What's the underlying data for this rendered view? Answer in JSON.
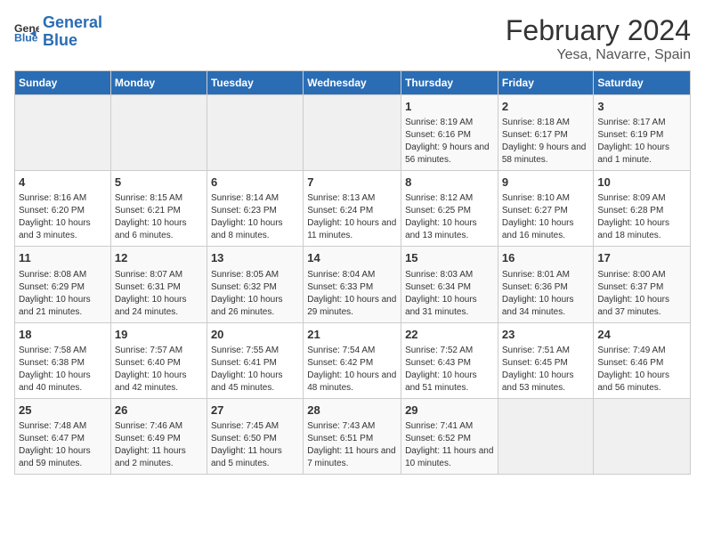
{
  "logo": {
    "line1": "General",
    "line2": "Blue"
  },
  "title": "February 2024",
  "subtitle": "Yesa, Navarre, Spain",
  "headers": [
    "Sunday",
    "Monday",
    "Tuesday",
    "Wednesday",
    "Thursday",
    "Friday",
    "Saturday"
  ],
  "weeks": [
    [
      {
        "day": "",
        "info": ""
      },
      {
        "day": "",
        "info": ""
      },
      {
        "day": "",
        "info": ""
      },
      {
        "day": "",
        "info": ""
      },
      {
        "day": "1",
        "info": "Sunrise: 8:19 AM\nSunset: 6:16 PM\nDaylight: 9 hours and 56 minutes."
      },
      {
        "day": "2",
        "info": "Sunrise: 8:18 AM\nSunset: 6:17 PM\nDaylight: 9 hours and 58 minutes."
      },
      {
        "day": "3",
        "info": "Sunrise: 8:17 AM\nSunset: 6:19 PM\nDaylight: 10 hours and 1 minute."
      }
    ],
    [
      {
        "day": "4",
        "info": "Sunrise: 8:16 AM\nSunset: 6:20 PM\nDaylight: 10 hours and 3 minutes."
      },
      {
        "day": "5",
        "info": "Sunrise: 8:15 AM\nSunset: 6:21 PM\nDaylight: 10 hours and 6 minutes."
      },
      {
        "day": "6",
        "info": "Sunrise: 8:14 AM\nSunset: 6:23 PM\nDaylight: 10 hours and 8 minutes."
      },
      {
        "day": "7",
        "info": "Sunrise: 8:13 AM\nSunset: 6:24 PM\nDaylight: 10 hours and 11 minutes."
      },
      {
        "day": "8",
        "info": "Sunrise: 8:12 AM\nSunset: 6:25 PM\nDaylight: 10 hours and 13 minutes."
      },
      {
        "day": "9",
        "info": "Sunrise: 8:10 AM\nSunset: 6:27 PM\nDaylight: 10 hours and 16 minutes."
      },
      {
        "day": "10",
        "info": "Sunrise: 8:09 AM\nSunset: 6:28 PM\nDaylight: 10 hours and 18 minutes."
      }
    ],
    [
      {
        "day": "11",
        "info": "Sunrise: 8:08 AM\nSunset: 6:29 PM\nDaylight: 10 hours and 21 minutes."
      },
      {
        "day": "12",
        "info": "Sunrise: 8:07 AM\nSunset: 6:31 PM\nDaylight: 10 hours and 24 minutes."
      },
      {
        "day": "13",
        "info": "Sunrise: 8:05 AM\nSunset: 6:32 PM\nDaylight: 10 hours and 26 minutes."
      },
      {
        "day": "14",
        "info": "Sunrise: 8:04 AM\nSunset: 6:33 PM\nDaylight: 10 hours and 29 minutes."
      },
      {
        "day": "15",
        "info": "Sunrise: 8:03 AM\nSunset: 6:34 PM\nDaylight: 10 hours and 31 minutes."
      },
      {
        "day": "16",
        "info": "Sunrise: 8:01 AM\nSunset: 6:36 PM\nDaylight: 10 hours and 34 minutes."
      },
      {
        "day": "17",
        "info": "Sunrise: 8:00 AM\nSunset: 6:37 PM\nDaylight: 10 hours and 37 minutes."
      }
    ],
    [
      {
        "day": "18",
        "info": "Sunrise: 7:58 AM\nSunset: 6:38 PM\nDaylight: 10 hours and 40 minutes."
      },
      {
        "day": "19",
        "info": "Sunrise: 7:57 AM\nSunset: 6:40 PM\nDaylight: 10 hours and 42 minutes."
      },
      {
        "day": "20",
        "info": "Sunrise: 7:55 AM\nSunset: 6:41 PM\nDaylight: 10 hours and 45 minutes."
      },
      {
        "day": "21",
        "info": "Sunrise: 7:54 AM\nSunset: 6:42 PM\nDaylight: 10 hours and 48 minutes."
      },
      {
        "day": "22",
        "info": "Sunrise: 7:52 AM\nSunset: 6:43 PM\nDaylight: 10 hours and 51 minutes."
      },
      {
        "day": "23",
        "info": "Sunrise: 7:51 AM\nSunset: 6:45 PM\nDaylight: 10 hours and 53 minutes."
      },
      {
        "day": "24",
        "info": "Sunrise: 7:49 AM\nSunset: 6:46 PM\nDaylight: 10 hours and 56 minutes."
      }
    ],
    [
      {
        "day": "25",
        "info": "Sunrise: 7:48 AM\nSunset: 6:47 PM\nDaylight: 10 hours and 59 minutes."
      },
      {
        "day": "26",
        "info": "Sunrise: 7:46 AM\nSunset: 6:49 PM\nDaylight: 11 hours and 2 minutes."
      },
      {
        "day": "27",
        "info": "Sunrise: 7:45 AM\nSunset: 6:50 PM\nDaylight: 11 hours and 5 minutes."
      },
      {
        "day": "28",
        "info": "Sunrise: 7:43 AM\nSunset: 6:51 PM\nDaylight: 11 hours and 7 minutes."
      },
      {
        "day": "29",
        "info": "Sunrise: 7:41 AM\nSunset: 6:52 PM\nDaylight: 11 hours and 10 minutes."
      },
      {
        "day": "",
        "info": ""
      },
      {
        "day": "",
        "info": ""
      }
    ]
  ]
}
